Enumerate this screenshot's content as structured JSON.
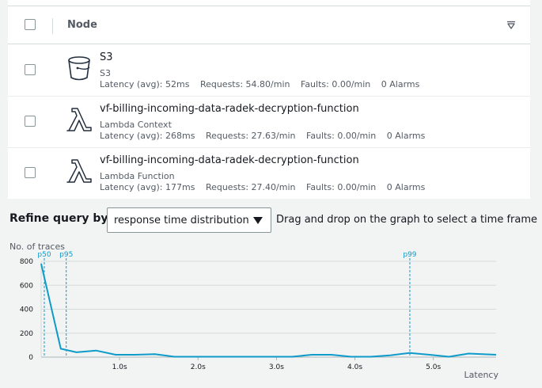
{
  "table": {
    "header": {
      "node_label": "Node"
    },
    "rows": [
      {
        "title": "S3",
        "subtitle": "S3",
        "icon": "s3-bucket-icon",
        "latency": "Latency (avg): 52ms",
        "requests": "Requests: 54.80/min",
        "faults": "Faults: 0.00/min",
        "alarms": "0 Alarms"
      },
      {
        "title": "vf-billing-incoming-data-radek-decryption-function",
        "subtitle": "Lambda Context",
        "icon": "lambda-icon",
        "latency": "Latency (avg): 268ms",
        "requests": "Requests: 27.63/min",
        "faults": "Faults: 0.00/min",
        "alarms": "0 Alarms"
      },
      {
        "title": "vf-billing-incoming-data-radek-decryption-function",
        "subtitle": "Lambda Function",
        "icon": "lambda-icon",
        "latency": "Latency (avg): 177ms",
        "requests": "Requests: 27.40/min",
        "faults": "Faults: 0.00/min",
        "alarms": "0 Alarms"
      }
    ]
  },
  "refine": {
    "label": "Refine query by",
    "selected": "response time distribution",
    "hint": "Drag and drop on the graph to select a time frame"
  },
  "colors": {
    "series": "#0f9bc9",
    "grid": "#d5dbdb",
    "text": "#16191f"
  },
  "chart_data": {
    "type": "line",
    "ylabel": "No. of traces",
    "xlabel": "Latency",
    "y_ticks": [
      "800",
      "600",
      "400",
      "200",
      "0"
    ],
    "y_tick_values": [
      800,
      600,
      400,
      200,
      0
    ],
    "x_ticks": [
      "1.0s",
      "2.0s",
      "3.0s",
      "4.0s",
      "5.0s"
    ],
    "x_tick_values": [
      1.0,
      2.0,
      3.0,
      4.0,
      5.0
    ],
    "xlim": [
      0.0,
      5.8
    ],
    "ylim": [
      0,
      800
    ],
    "markers": [
      {
        "label": "p50",
        "x": 0.04
      },
      {
        "label": "p95",
        "x": 0.32
      },
      {
        "label": "p99",
        "x": 4.7
      }
    ],
    "series": [
      {
        "x": [
          0.0,
          0.25,
          0.45,
          0.7,
          0.95,
          1.2,
          1.45,
          1.7,
          1.95,
          2.2,
          2.45,
          2.7,
          2.95,
          3.2,
          3.45,
          3.7,
          3.95,
          4.2,
          4.45,
          4.7,
          4.95,
          5.2,
          5.45,
          5.8
        ],
        "y": [
          780,
          70,
          40,
          55,
          20,
          20,
          25,
          3,
          3,
          3,
          3,
          3,
          3,
          3,
          20,
          20,
          3,
          3,
          15,
          35,
          20,
          3,
          30,
          20
        ]
      }
    ]
  }
}
